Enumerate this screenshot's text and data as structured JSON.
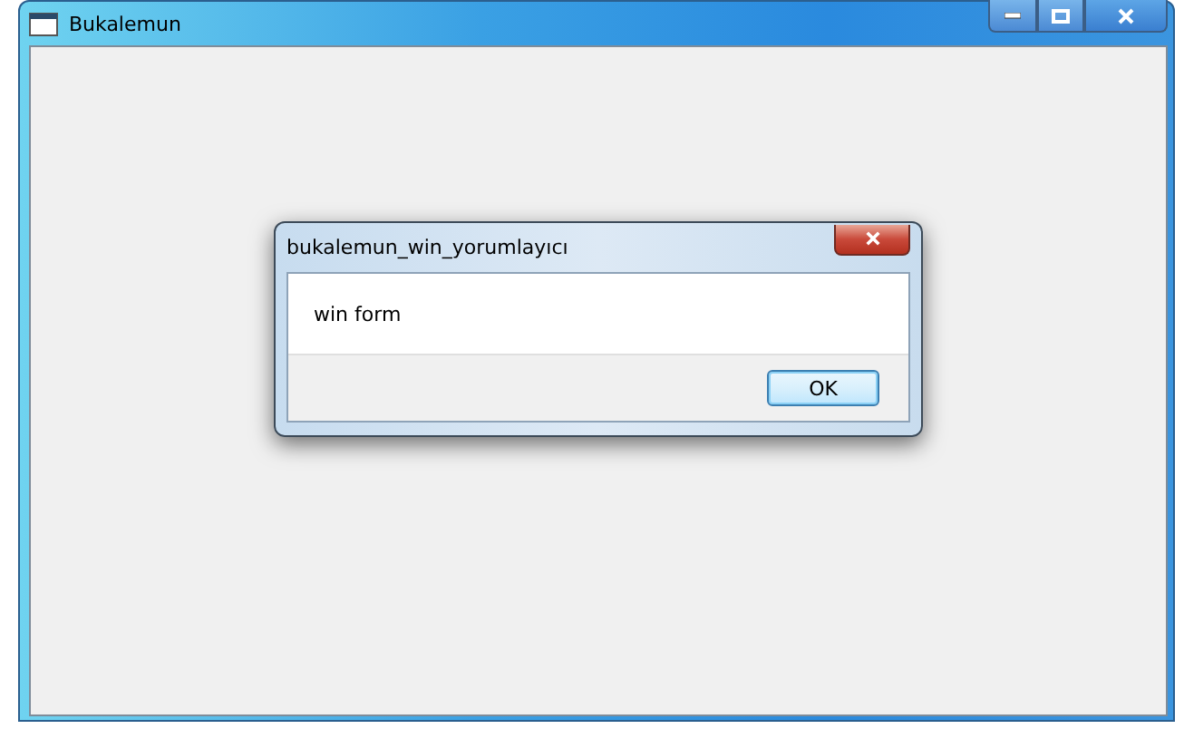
{
  "window": {
    "title": "Bukalemun"
  },
  "dialog": {
    "title": "bukalemun_win_yorumlayıcı",
    "message": "win form",
    "buttons": [
      "OK"
    ]
  }
}
